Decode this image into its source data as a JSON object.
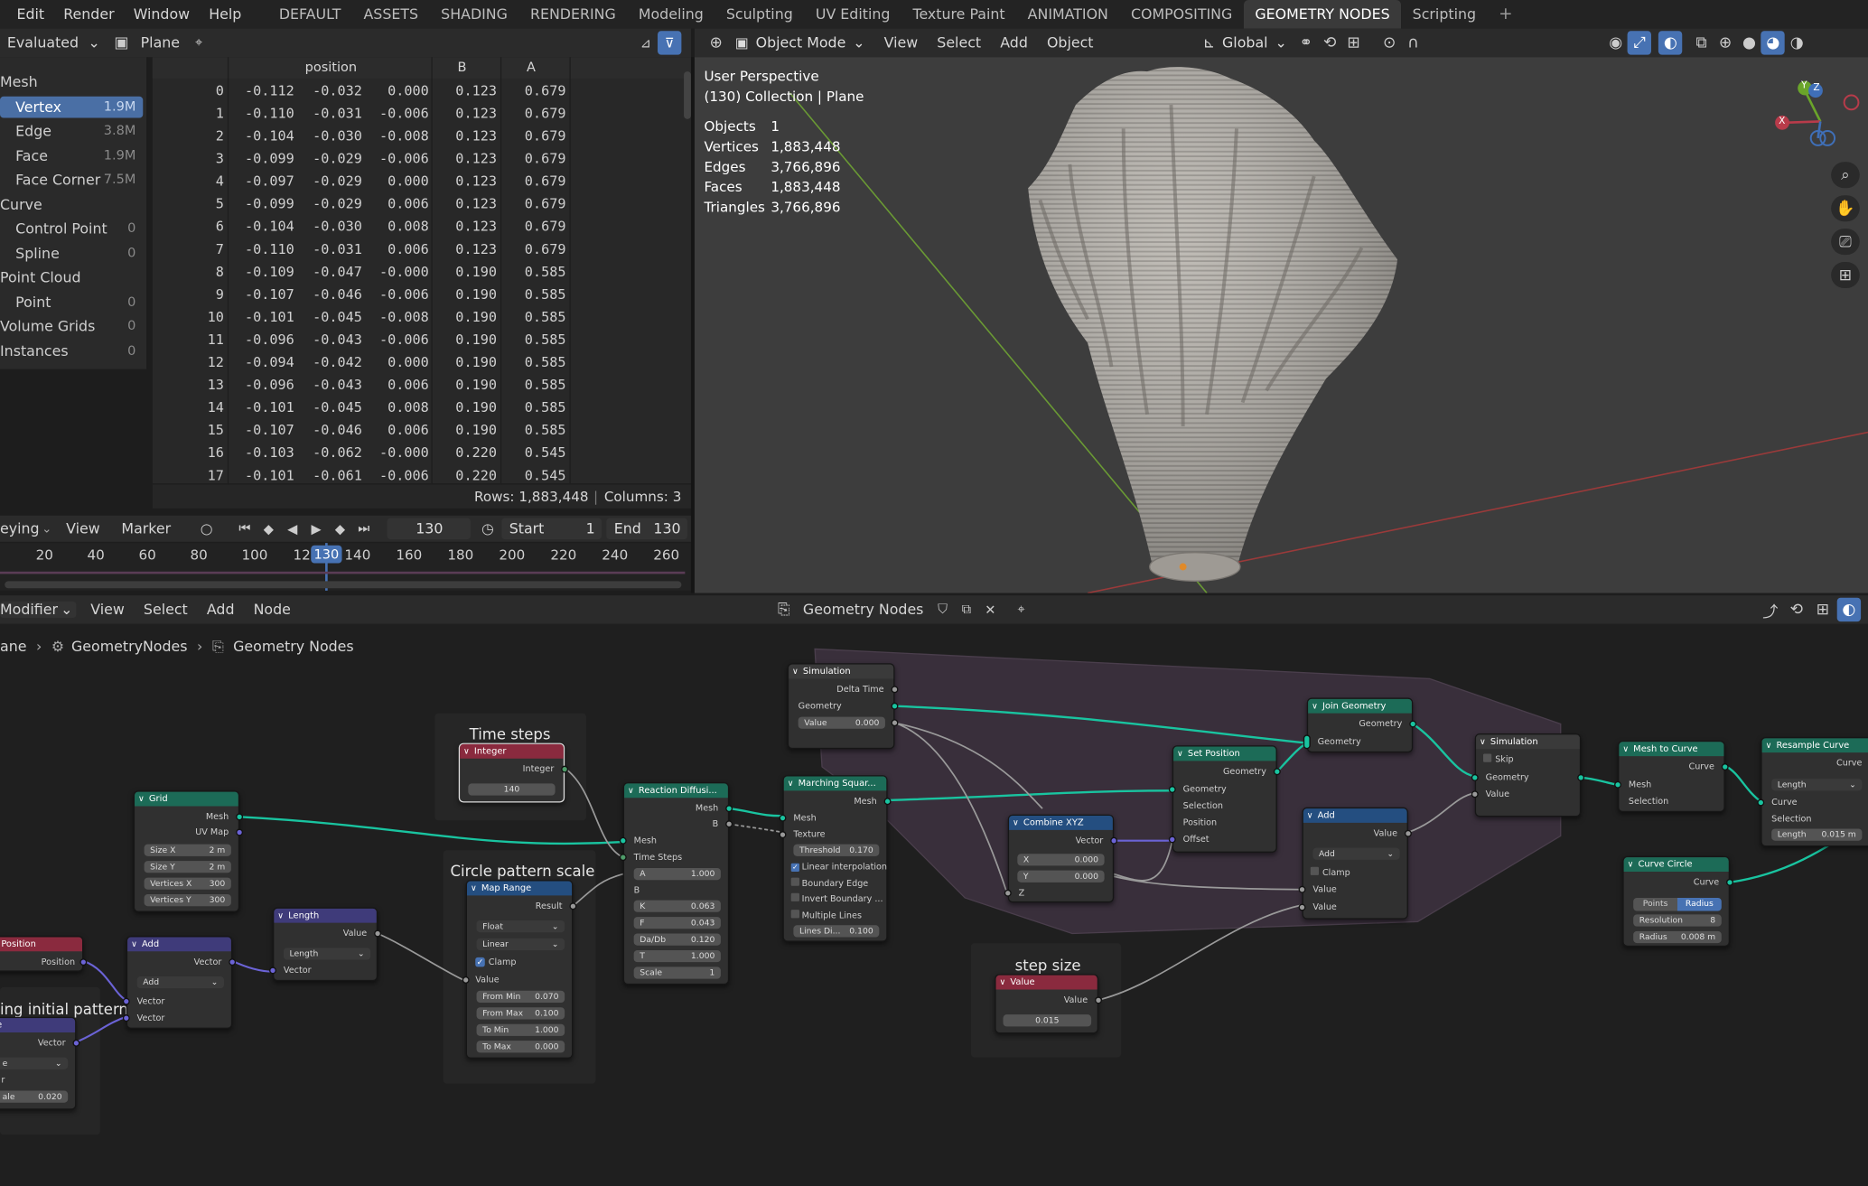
{
  "menu": {
    "items": [
      "Edit",
      "Render",
      "Window",
      "Help"
    ],
    "workspaces": [
      "DEFAULT",
      "ASSETS",
      "SHADING",
      "RENDERING",
      "Modeling",
      "Sculpting",
      "UV Editing",
      "Texture Paint",
      "ANIMATION",
      "COMPOSITING",
      "GEOMETRY NODES",
      "Scripting"
    ],
    "active_workspace": "GEOMETRY NODES",
    "add_tab": "+"
  },
  "spreadsheet": {
    "mode": "Evaluated",
    "object": "Plane",
    "column_headers": [
      "position",
      "B",
      "A"
    ],
    "domains": [
      {
        "label": "Mesh",
        "count": ""
      },
      {
        "label": "Vertex",
        "count": "1.9M"
      },
      {
        "label": "Edge",
        "count": "3.8M"
      },
      {
        "label": "Face",
        "count": "1.9M"
      },
      {
        "label": "Face Corner",
        "count": "7.5M"
      },
      {
        "label": "Curve",
        "count": ""
      },
      {
        "label": "Control Point",
        "count": "0"
      },
      {
        "label": "Spline",
        "count": "0"
      },
      {
        "label": "Point Cloud",
        "count": ""
      },
      {
        "label": "Point",
        "count": "0"
      },
      {
        "label": "Volume Grids",
        "count": "0"
      },
      {
        "label": "Instances",
        "count": "0"
      }
    ],
    "rows": [
      [
        "0",
        "-0.112",
        "-0.032",
        "0.000",
        "0.123",
        "0.679"
      ],
      [
        "1",
        "-0.110",
        "-0.031",
        "-0.006",
        "0.123",
        "0.679"
      ],
      [
        "2",
        "-0.104",
        "-0.030",
        "-0.008",
        "0.123",
        "0.679"
      ],
      [
        "3",
        "-0.099",
        "-0.029",
        "-0.006",
        "0.123",
        "0.679"
      ],
      [
        "4",
        "-0.097",
        "-0.029",
        "0.000",
        "0.123",
        "0.679"
      ],
      [
        "5",
        "-0.099",
        "-0.029",
        "0.006",
        "0.123",
        "0.679"
      ],
      [
        "6",
        "-0.104",
        "-0.030",
        "0.008",
        "0.123",
        "0.679"
      ],
      [
        "7",
        "-0.110",
        "-0.031",
        "0.006",
        "0.123",
        "0.679"
      ],
      [
        "8",
        "-0.109",
        "-0.047",
        "-0.000",
        "0.190",
        "0.585"
      ],
      [
        "9",
        "-0.107",
        "-0.046",
        "-0.006",
        "0.190",
        "0.585"
      ],
      [
        "10",
        "-0.101",
        "-0.045",
        "-0.008",
        "0.190",
        "0.585"
      ],
      [
        "11",
        "-0.096",
        "-0.043",
        "-0.006",
        "0.190",
        "0.585"
      ],
      [
        "12",
        "-0.094",
        "-0.042",
        "0.000",
        "0.190",
        "0.585"
      ],
      [
        "13",
        "-0.096",
        "-0.043",
        "0.006",
        "0.190",
        "0.585"
      ],
      [
        "14",
        "-0.101",
        "-0.045",
        "0.008",
        "0.190",
        "0.585"
      ],
      [
        "15",
        "-0.107",
        "-0.046",
        "0.006",
        "0.190",
        "0.585"
      ],
      [
        "16",
        "-0.103",
        "-0.062",
        "-0.000",
        "0.220",
        "0.545"
      ],
      [
        "17",
        "-0.101",
        "-0.061",
        "-0.006",
        "0.220",
        "0.545"
      ]
    ],
    "rows_label": "Rows: 1,883,448",
    "columns_label": "Columns: 3"
  },
  "timeline": {
    "mode": "eying",
    "view": "View",
    "marker": "Marker",
    "current_frame": "130",
    "start_label": "Start",
    "start": "1",
    "end_label": "End",
    "end": "130",
    "ticks": [
      "20",
      "40",
      "60",
      "80",
      "100",
      "120",
      "140",
      "160",
      "180",
      "200",
      "220",
      "240",
      "260"
    ],
    "playhead": "130"
  },
  "viewport": {
    "mode": "Object Mode",
    "menus": [
      "View",
      "Select",
      "Add",
      "Object"
    ],
    "orientation": "Global",
    "info_title": "User Perspective",
    "info_collection": "(130) Collection | Plane",
    "stats": [
      {
        "label": "Objects",
        "value": "1"
      },
      {
        "label": "Vertices",
        "value": "1,883,448"
      },
      {
        "label": "Edges",
        "value": "3,766,896"
      },
      {
        "label": "Faces",
        "value": "1,883,448"
      },
      {
        "label": "Triangles",
        "value": "3,766,896"
      }
    ],
    "gizmo": {
      "x": "X",
      "y": "Y",
      "z": "Z"
    }
  },
  "node_editor": {
    "mode": "Modifier",
    "menus": [
      "View",
      "Select",
      "Add",
      "Node"
    ],
    "tree_name": "Geometry Nodes",
    "breadcrumb": [
      "ane",
      "GeometryNodes",
      "Geometry Nodes"
    ],
    "frames": {
      "time_steps": "Time steps",
      "circle_scale": "Circle pattern scale",
      "step_size": "step size",
      "initial_pattern": "ing initial pattern"
    },
    "nodes": {
      "grid": {
        "title": "Grid",
        "mesh": "Mesh",
        "uvmap": "UV Map",
        "size_x": "Size X",
        "size_x_v": "2 m",
        "size_y": "Size Y",
        "size_y_v": "2 m",
        "vx": "Vertices X",
        "vx_v": "300",
        "vy": "Vertices Y",
        "vy_v": "300"
      },
      "integer": {
        "title": "Integer",
        "out": "Integer",
        "value": "140"
      },
      "length": {
        "title": "Length",
        "out": "Value",
        "mode": "Length",
        "in": "Vector"
      },
      "position": {
        "title": "Position",
        "out": "Position"
      },
      "add_vec": {
        "title": "Add",
        "out": "Vector",
        "op": "Add",
        "in1": "Vector",
        "in2": "Vector"
      },
      "vec_partial": {
        "out": "Vector",
        "l1": "le",
        "l2": "e",
        "l3": "r",
        "l4": "ale",
        "v4": "0.020"
      },
      "map_range": {
        "title": "Map Range",
        "out": "Result",
        "type": "Float",
        "interp": "Linear",
        "clamp": "Clamp",
        "value": "Value",
        "from_min": "From Min",
        "from_min_v": "0.070",
        "from_max": "From Max",
        "from_max_v": "0.100",
        "to_min": "To Min",
        "to_min_v": "1.000",
        "to_max": "To Max",
        "to_max_v": "0.000"
      },
      "reaction": {
        "title": "Reaction Diffusi...",
        "mesh_out": "Mesh",
        "b_out": "B",
        "mesh_in": "Mesh",
        "time_steps": "Time Steps",
        "a": "A",
        "a_v": "1.000",
        "b": "B",
        "k": "K",
        "k_v": "0.063",
        "f": "F",
        "f_v": "0.043",
        "dadb": "Da/Db",
        "dadb_v": "0.120",
        "t": "T",
        "t_v": "1.000",
        "scale": "Scale",
        "scale_v": "1"
      },
      "sim_in": {
        "title": "Simulation",
        "delta": "Delta Time",
        "geo": "Geometry",
        "value": "Value",
        "value_v": "0.000"
      },
      "marching": {
        "title": "Marching Squar...",
        "mesh_out": "Mesh",
        "mesh_in": "Mesh",
        "texture": "Texture",
        "threshold": "Threshold",
        "threshold_v": "0.170",
        "lin": "Linear interpolation",
        "boundary": "Boundary Edge",
        "invert": "Invert Boundary ...",
        "multi": "Multiple Lines",
        "lines": "Lines Di...",
        "lines_v": "0.100"
      },
      "combine": {
        "title": "Combine XYZ",
        "out": "Vector",
        "x": "X",
        "x_v": "0.000",
        "y": "Y",
        "y_v": "0.000",
        "z": "Z"
      },
      "set_pos": {
        "title": "Set Position",
        "out": "Geometry",
        "geo": "Geometry",
        "sel": "Selection",
        "pos": "Position",
        "off": "Offset"
      },
      "join": {
        "title": "Join Geometry",
        "out": "Geometry",
        "in": "Geometry"
      },
      "add_math": {
        "title": "Add",
        "out": "Value",
        "op": "Add",
        "clamp": "Clamp",
        "v1": "Value",
        "v2": "Value"
      },
      "value": {
        "title": "Value",
        "out": "Value",
        "v": "0.015"
      },
      "sim_out": {
        "title": "Simulation",
        "skip": "Skip",
        "geo": "Geometry",
        "value": "Value"
      },
      "mesh_curve": {
        "title": "Mesh to Curve",
        "out": "Curve",
        "mesh": "Mesh",
        "sel": "Selection"
      },
      "resample": {
        "title": "Resample Curve",
        "out": "Curve",
        "mode": "Length",
        "curve": "Curve",
        "sel": "Selection",
        "len": "Length",
        "len_v": "0.015 m"
      },
      "circle": {
        "title": "Curve Circle",
        "out": "Curve",
        "points": "Points",
        "radius_tab": "Radius",
        "res": "Resolution",
        "res_v": "8",
        "radius": "Radius",
        "radius_v": "0.008 m"
      }
    }
  }
}
